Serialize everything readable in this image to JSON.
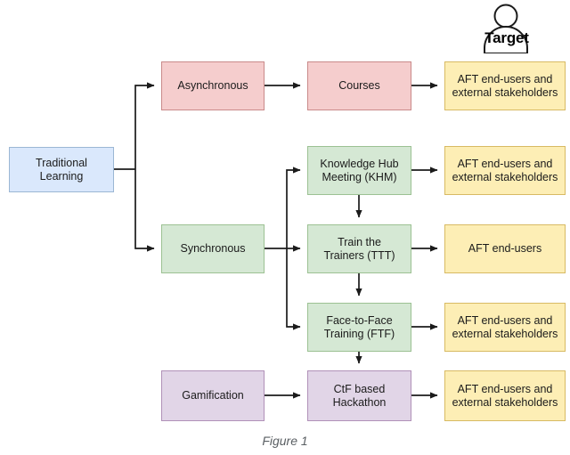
{
  "figure": {
    "caption": "Figure 1",
    "actor_label": "Target",
    "actor_icon": "person-actor-icon"
  },
  "palette": {
    "blue_fill": "#dae8fc",
    "blue_stroke": "#9bb7d4",
    "pink_fill": "#f5cdcd",
    "pink_stroke": "#c98a8a",
    "green_fill": "#d5e8d4",
    "green_stroke": "#9cc193",
    "purple_fill": "#e1d5e7",
    "purple_stroke": "#b091b8",
    "yellow_fill": "#fdeeb5",
    "yellow_stroke": "#d8ba63",
    "edge_stroke": "#1b1b1b",
    "caption_color": "#5a5f63"
  },
  "nodes": {
    "traditional_learning": "Traditional\nLearning",
    "asynchronous": "Asynchronous",
    "synchronous": "Synchronous",
    "gamification": "Gamification",
    "courses": "Courses",
    "khm": "Knowledge Hub\nMeeting (KHM)",
    "ttt": "Train the\nTrainers (TTT)",
    "ftf": "Face-to-Face\nTraining (FTF)",
    "ctf": "CtF based\nHackathon",
    "target_courses": "AFT end-users and\nexternal stakeholders",
    "target_khm": "AFT end-users and\nexternal stakeholders",
    "target_ttt": "AFT end-users",
    "target_ftf": "AFT end-users and\nexternal stakeholders",
    "target_ctf": "AFT end-users and\nexternal stakeholders"
  },
  "chart_data": {
    "type": "diagram",
    "title": "Figure 1",
    "layout": "left-to-right flowchart",
    "nodes": [
      {
        "id": "traditional_learning",
        "label": "Traditional Learning",
        "color": "#dae8fc",
        "column": 1
      },
      {
        "id": "asynchronous",
        "label": "Asynchronous",
        "color": "#f5cdcd",
        "column": 2
      },
      {
        "id": "synchronous",
        "label": "Synchronous",
        "color": "#d5e8d4",
        "column": 2
      },
      {
        "id": "gamification",
        "label": "Gamification",
        "color": "#e1d5e7",
        "column": 2
      },
      {
        "id": "courses",
        "label": "Courses",
        "color": "#f5cdcd",
        "column": 3
      },
      {
        "id": "khm",
        "label": "Knowledge Hub Meeting (KHM)",
        "color": "#d5e8d4",
        "column": 3
      },
      {
        "id": "ttt",
        "label": "Train the Trainers (TTT)",
        "color": "#d5e8d4",
        "column": 3
      },
      {
        "id": "ftf",
        "label": "Face-to-Face Training (FTF)",
        "color": "#d5e8d4",
        "column": 3
      },
      {
        "id": "ctf",
        "label": "CtF based Hackathon",
        "color": "#e1d5e7",
        "column": 3
      },
      {
        "id": "target_courses",
        "label": "AFT end-users and external stakeholders",
        "color": "#fdeeb5",
        "column": 4
      },
      {
        "id": "target_khm",
        "label": "AFT end-users and external stakeholders",
        "color": "#fdeeb5",
        "column": 4
      },
      {
        "id": "target_ttt",
        "label": "AFT end-users",
        "color": "#fdeeb5",
        "column": 4
      },
      {
        "id": "target_ftf",
        "label": "AFT end-users and external stakeholders",
        "color": "#fdeeb5",
        "column": 4
      },
      {
        "id": "target_ctf",
        "label": "AFT end-users and external stakeholders",
        "color": "#fdeeb5",
        "column": 4
      }
    ],
    "edges": [
      {
        "from": "traditional_learning",
        "to": "asynchronous"
      },
      {
        "from": "traditional_learning",
        "to": "synchronous"
      },
      {
        "from": "asynchronous",
        "to": "courses"
      },
      {
        "from": "courses",
        "to": "target_courses"
      },
      {
        "from": "synchronous",
        "to": "khm"
      },
      {
        "from": "synchronous",
        "to": "ttt"
      },
      {
        "from": "synchronous",
        "to": "ftf"
      },
      {
        "from": "khm",
        "to": "ttt"
      },
      {
        "from": "ttt",
        "to": "ftf"
      },
      {
        "from": "ftf",
        "to": "ctf"
      },
      {
        "from": "khm",
        "to": "target_khm"
      },
      {
        "from": "ttt",
        "to": "target_ttt"
      },
      {
        "from": "ftf",
        "to": "target_ftf"
      },
      {
        "from": "gamification",
        "to": "ctf"
      },
      {
        "from": "ctf",
        "to": "target_ctf"
      }
    ],
    "annotations": [
      {
        "id": "actor",
        "label": "Target",
        "shape": "person-actor-icon",
        "near": "target_courses"
      }
    ]
  }
}
